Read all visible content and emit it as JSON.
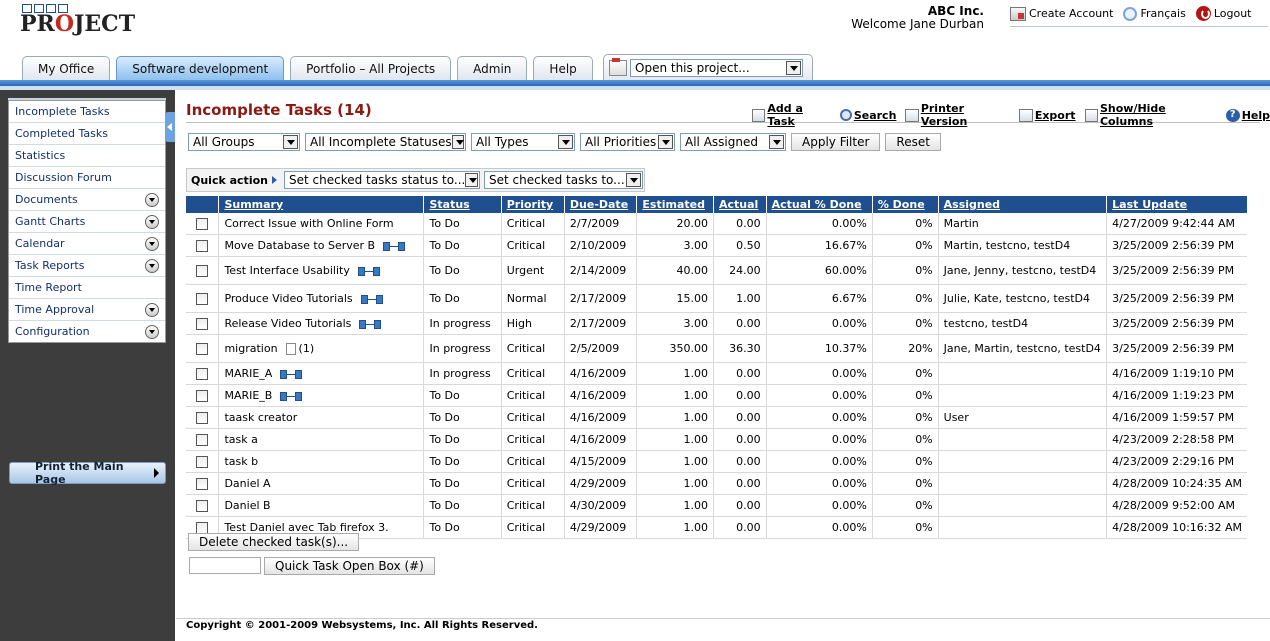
{
  "header": {
    "logo_text_pre": "PR",
    "logo_text_o": "O",
    "logo_text_post": "JECT",
    "company": "ABC Inc.",
    "welcome": "Welcome Jane Durban",
    "links": [
      {
        "icon": "create-account-icon",
        "label": "Create Account"
      },
      {
        "icon": "globe-icon",
        "label": "Français"
      },
      {
        "icon": "logout-icon",
        "label": "Logout"
      }
    ]
  },
  "tabs": [
    "My Office",
    "Software development",
    "Portfolio – All Projects",
    "Admin",
    "Help"
  ],
  "active_tab": 1,
  "open_project": "Open this project...",
  "sidebar": {
    "items": [
      {
        "label": "Incomplete Tasks",
        "expand": false
      },
      {
        "label": "Completed Tasks",
        "expand": false
      },
      {
        "label": "Statistics",
        "expand": false
      },
      {
        "label": "Discussion Forum",
        "expand": false
      },
      {
        "label": "Documents",
        "expand": true
      },
      {
        "label": "Gantt Charts",
        "expand": true
      },
      {
        "label": "Calendar",
        "expand": true
      },
      {
        "label": "Task Reports",
        "expand": true
      },
      {
        "label": "Time Report",
        "expand": false
      },
      {
        "label": "Time Approval",
        "expand": true
      },
      {
        "label": "Configuration",
        "expand": true
      }
    ],
    "print_button": "Print the Main Page"
  },
  "page": {
    "title": "Incomplete Tasks (14)",
    "actions": [
      "Add a Task",
      "Search",
      "Printer Version",
      "Export",
      "Show/Hide Columns",
      "Help"
    ]
  },
  "filters": {
    "groups": "All Groups",
    "statuses": "All Incomplete Statuses",
    "types": "All Types",
    "priorities": "All Priorities",
    "assigned": "All Assigned",
    "apply": "Apply Filter",
    "reset": "Reset"
  },
  "quick_action": {
    "label": "Quick action",
    "status_select": "Set checked tasks status to...",
    "tasks_select": "Set checked tasks to..."
  },
  "table": {
    "columns": [
      "Summary",
      "Status",
      "Priority",
      "Due-Date",
      "Estimated",
      "Actual",
      "Actual % Done",
      "% Done",
      "Assigned",
      "Last Update"
    ],
    "rows": [
      {
        "summary": "Correct Issue with Online Form",
        "dep": false,
        "doc": "",
        "status": "To Do",
        "priority": "Critical",
        "due": "2/7/2009",
        "estimated": "20.00",
        "actual": "0.00",
        "actual_pct": "0.00%",
        "pct": "0%",
        "assigned": "Martin",
        "last_update": "4/27/2009 9:42:44 AM"
      },
      {
        "summary": "Move Database to Server B",
        "dep": true,
        "doc": "",
        "status": "To Do",
        "priority": "Critical",
        "due": "2/10/2009",
        "estimated": "3.00",
        "actual": "0.50",
        "actual_pct": "16.67%",
        "pct": "0%",
        "assigned": "Martin, testcno, testD4",
        "last_update": "3/25/2009 2:56:39 PM"
      },
      {
        "summary": "Test Interface Usability",
        "dep": true,
        "doc": "",
        "status": "To Do",
        "priority": "Urgent",
        "due": "2/14/2009",
        "estimated": "40.00",
        "actual": "24.00",
        "actual_pct": "60.00%",
        "pct": "0%",
        "assigned": "Jane, Jenny, testcno, testD4",
        "last_update": "3/25/2009 2:56:39 PM"
      },
      {
        "summary": "Produce Video Tutorials",
        "dep": true,
        "doc": "",
        "status": "To Do",
        "priority": "Normal",
        "due": "2/17/2009",
        "estimated": "15.00",
        "actual": "1.00",
        "actual_pct": "6.67%",
        "pct": "0%",
        "assigned": "Julie, Kate, testcno, testD4",
        "last_update": "3/25/2009 2:56:39 PM"
      },
      {
        "summary": "Release Video Tutorials",
        "dep": true,
        "doc": "",
        "status": "In progress",
        "priority": "High",
        "due": "2/17/2009",
        "estimated": "3.00",
        "actual": "0.00",
        "actual_pct": "0.00%",
        "pct": "0%",
        "assigned": "testcno, testD4",
        "last_update": "3/25/2009 2:56:39 PM"
      },
      {
        "summary": "migration",
        "dep": false,
        "doc": "(1)",
        "status": "In progress",
        "priority": "Critical",
        "due": "2/5/2009",
        "estimated": "350.00",
        "actual": "36.30",
        "actual_pct": "10.37%",
        "pct": "20%",
        "assigned": "Jane, Martin, testcno, testD4",
        "last_update": "3/25/2009 2:56:39 PM"
      },
      {
        "summary": "MARIE_A",
        "dep": true,
        "doc": "",
        "status": "In progress",
        "priority": "Critical",
        "due": "4/16/2009",
        "estimated": "1.00",
        "actual": "0.00",
        "actual_pct": "0.00%",
        "pct": "0%",
        "assigned": "",
        "last_update": "4/16/2009 1:19:10 PM"
      },
      {
        "summary": "MARIE_B",
        "dep": true,
        "doc": "",
        "status": "To Do",
        "priority": "Critical",
        "due": "4/16/2009",
        "estimated": "1.00",
        "actual": "0.00",
        "actual_pct": "0.00%",
        "pct": "0%",
        "assigned": "",
        "last_update": "4/16/2009 1:19:23 PM"
      },
      {
        "summary": "taask creator",
        "dep": false,
        "doc": "",
        "status": "To Do",
        "priority": "Critical",
        "due": "4/16/2009",
        "estimated": "1.00",
        "actual": "0.00",
        "actual_pct": "0.00%",
        "pct": "0%",
        "assigned": "User",
        "last_update": "4/16/2009 1:59:57 PM"
      },
      {
        "summary": "task a",
        "dep": false,
        "doc": "",
        "status": "To Do",
        "priority": "Critical",
        "due": "4/16/2009",
        "estimated": "1.00",
        "actual": "0.00",
        "actual_pct": "0.00%",
        "pct": "0%",
        "assigned": "",
        "last_update": "4/23/2009 2:28:58 PM"
      },
      {
        "summary": "task b",
        "dep": false,
        "doc": "",
        "status": "To Do",
        "priority": "Critical",
        "due": "4/15/2009",
        "estimated": "1.00",
        "actual": "0.00",
        "actual_pct": "0.00%",
        "pct": "0%",
        "assigned": "",
        "last_update": "4/23/2009 2:29:16 PM"
      },
      {
        "summary": "Daniel A",
        "dep": false,
        "doc": "",
        "status": "To Do",
        "priority": "Critical",
        "due": "4/29/2009",
        "estimated": "1.00",
        "actual": "0.00",
        "actual_pct": "0.00%",
        "pct": "0%",
        "assigned": "",
        "last_update": "4/28/2009 10:24:35 AM"
      },
      {
        "summary": "Daniel B",
        "dep": false,
        "doc": "",
        "status": "To Do",
        "priority": "Critical",
        "due": "4/30/2009",
        "estimated": "1.00",
        "actual": "0.00",
        "actual_pct": "0.00%",
        "pct": "0%",
        "assigned": "",
        "last_update": "4/28/2009 9:52:00 AM"
      },
      {
        "summary": "Test Daniel avec Tab firefox 3.",
        "dep": false,
        "doc": "",
        "status": "To Do",
        "priority": "Critical",
        "due": "4/29/2009",
        "estimated": "1.00",
        "actual": "0.00",
        "actual_pct": "0.00%",
        "pct": "0%",
        "assigned": "",
        "last_update": "4/28/2009 10:16:32 AM"
      }
    ]
  },
  "bottom": {
    "delete_button": "Delete checked task(s)...",
    "quick_open_input": "",
    "quick_open_button": "Quick Task Open Box (#)"
  },
  "footer": "Copyright © 2001-2009 Websystems, Inc. All Rights Reserved.",
  "colors": {
    "accent": "#1f4f8f",
    "title": "#8a1a12",
    "sidebar": "#3d3d3d"
  }
}
